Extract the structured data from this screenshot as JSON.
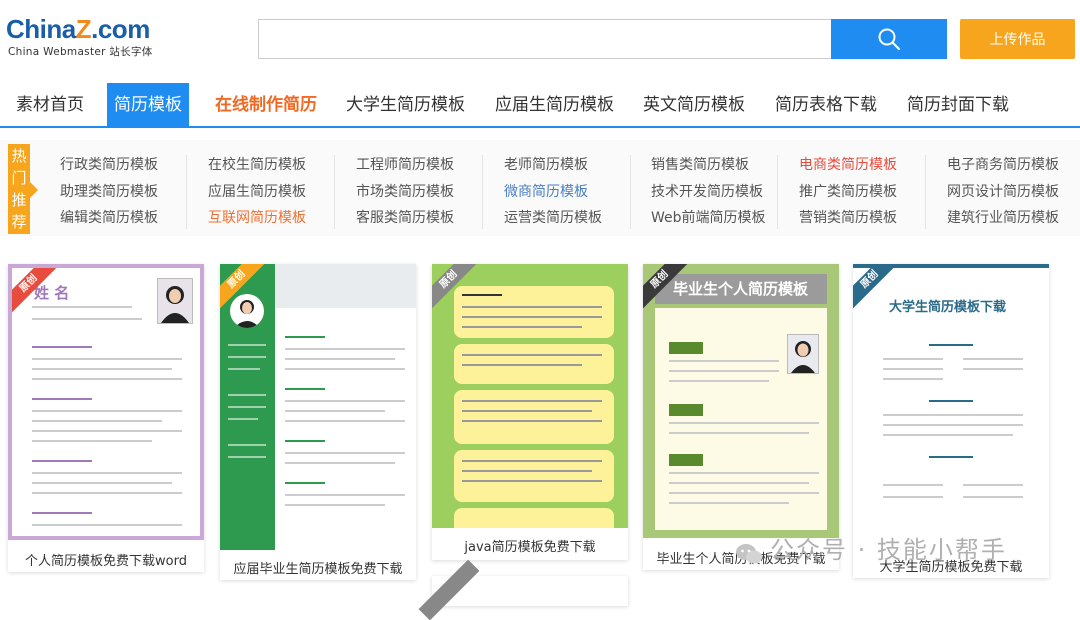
{
  "logo": {
    "main_a": "China",
    "main_z": "Z",
    "main_b": ".com",
    "sub": "China Webmaster 站长字体"
  },
  "search": {
    "placeholder": "",
    "value": ""
  },
  "header": {
    "upload_label": "上传作品"
  },
  "nav": [
    "素材首页",
    "简历模板",
    "在线制作简历",
    "大学生简历模板",
    "应届生简历模板",
    "英文简历模板",
    "简历表格下载",
    "简历封面下载"
  ],
  "hot": {
    "label": "热门推荐",
    "columns": [
      [
        "行政类简历模板",
        "助理类简历模板",
        "编辑类简历模板"
      ],
      [
        "在校生简历模板",
        "应届生简历模板",
        "互联网简历模板"
      ],
      [
        "工程师简历模板",
        "市场类简历模板",
        "客服类简历模板"
      ],
      [
        "老师简历模板",
        "微商简历模板",
        "运营类简历模板"
      ],
      [
        "销售类简历模板",
        "技术开发简历模板",
        "Web前端简历模板"
      ],
      [
        "电商类简历模板",
        "推广类简历模板",
        "营销类简历模板"
      ],
      [
        "电子商务简历模板",
        "网页设计简历模板",
        "建筑行业简历模板"
      ]
    ]
  },
  "cards": [
    {
      "title": "个人简历模板免费下载word",
      "ribbon": "原创",
      "accent": "#c9a8d8",
      "head": "姓 名"
    },
    {
      "title": "应届毕业生简历模板免费下载",
      "ribbon": "原创",
      "accent": "#2e9a4f",
      "head": ""
    },
    {
      "title": "java简历模板免费下载",
      "ribbon": "原创",
      "accent": "#9ccf5e",
      "head": ""
    },
    {
      "title": "毕业生个人简历模板免费下载",
      "ribbon": "原创",
      "accent": "#a8c878",
      "head": "毕业生个人简历模板"
    },
    {
      "title": "大学生简历模板免费下载",
      "ribbon": "原创",
      "accent": "#2a6a8a",
      "head": "大学生简历模板下载"
    }
  ],
  "watermark": "公众号 · 技能小帮手",
  "colors": {
    "primary": "#1e8cf0",
    "orange": "#f7a51c",
    "hot_red": "#e84c3d",
    "hot_blue": "#4a7fc1"
  }
}
